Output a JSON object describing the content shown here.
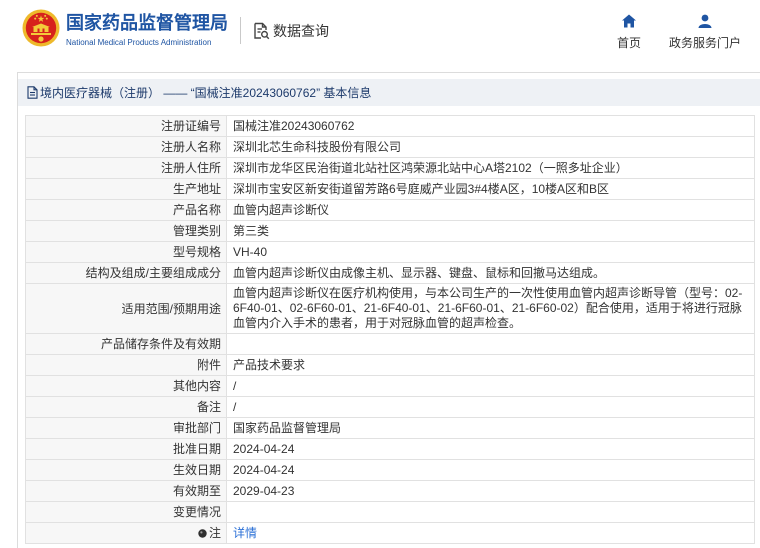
{
  "colors": {
    "brand_blue": "#1f55a3",
    "emblem_red": "#d7221c",
    "emblem_gold": "#eeb92b",
    "title_bar_bg": "#eef1f5",
    "label_bg": "#f7f7f7",
    "link_blue": "#2a6fd6"
  },
  "header": {
    "logo_icon": "national-emblem-icon",
    "agency_name": "国家药品监督管理局",
    "agency_name_en": "National Medical Products Administration",
    "section_icon": "search-document-icon",
    "section_title": "数据查询",
    "nav": [
      {
        "icon": "home-icon",
        "label": "首页"
      },
      {
        "icon": "user-icon",
        "label": "政务服务门户"
      }
    ]
  },
  "record": {
    "title_icon": "document-icon",
    "title": "境内医疗器械（注册） —— “国械注准20243060762” 基本信息",
    "rows": [
      {
        "label": "注册证编号",
        "value": "国械注准20243060762"
      },
      {
        "label": "注册人名称",
        "value": "深圳北芯生命科技股份有限公司"
      },
      {
        "label": "注册人住所",
        "value": "深圳市龙华区民治街道北站社区鸿荣源北站中心A塔2102（一照多址企业）"
      },
      {
        "label": "生产地址",
        "value": "深圳市宝安区新安街道留芳路6号庭威产业园3#4楼A区，10楼A区和B区"
      },
      {
        "label": "产品名称",
        "value": "血管内超声诊断仪"
      },
      {
        "label": "管理类别",
        "value": "第三类"
      },
      {
        "label": "型号规格",
        "value": "VH-40"
      },
      {
        "label": "结构及组成/主要组成成分",
        "value": "血管内超声诊断仪由成像主机、显示器、键盘、鼠标和回撤马达组成。"
      },
      {
        "label": "适用范围/预期用途",
        "value": "血管内超声诊断仪在医疗机构使用，与本公司生产的一次性使用血管内超声诊断导管（型号：02-6F40-01、02-6F60-01、21-6F40-01、21-6F60-01、21-6F60-02）配合使用，适用于将进行冠脉血管内介入手术的患者，用于对冠脉血管的超声检查。"
      },
      {
        "label": "产品储存条件及有效期",
        "value": ""
      },
      {
        "label": "附件",
        "value": "产品技术要求"
      },
      {
        "label": "其他内容",
        "value": "/"
      },
      {
        "label": "备注",
        "value": "/"
      },
      {
        "label": "审批部门",
        "value": "国家药品监督管理局"
      },
      {
        "label": "批准日期",
        "value": "2024-04-24"
      },
      {
        "label": "生效日期",
        "value": "2024-04-24"
      },
      {
        "label": "有效期至",
        "value": "2029-04-23"
      },
      {
        "label": "变更情况",
        "value": ""
      },
      {
        "label": "注",
        "icon": "tip-icon",
        "value": "详情"
      }
    ]
  }
}
